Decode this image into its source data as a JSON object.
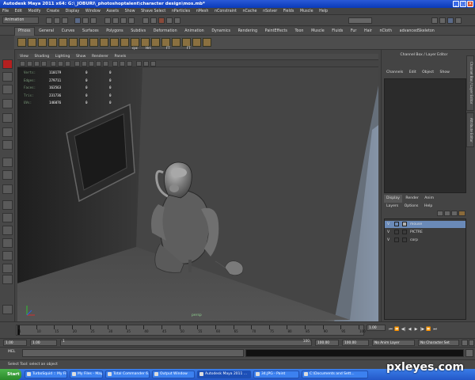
{
  "window": {
    "title": "Autodesk Maya 2011 x64: G:\\_JOBURI\\_photoshoptalent\\character design\\mos.mb*",
    "controls": [
      "_",
      "□",
      "×"
    ]
  },
  "menubar": [
    "File",
    "Edit",
    "Modify",
    "Create",
    "Display",
    "Window",
    "Assets",
    "Show",
    "Shave Select",
    "nParticles",
    "nMesh",
    "nConstraint",
    "nCache",
    "nSolver",
    "Fields",
    "Muscle",
    "Help"
  ],
  "status_line": {
    "mode": "Animation"
  },
  "shelf": {
    "tabs": [
      "Pfnoss",
      "General",
      "Curves",
      "Surfaces",
      "Polygons",
      "Subdivs",
      "Deformation",
      "Animation",
      "Dynamics",
      "Rendering",
      "PaintEffects",
      "Toon",
      "Muscle",
      "Fluids",
      "Fur",
      "Hair",
      "nCloth",
      "advancedSkeleton"
    ],
    "active_tab": 0,
    "icon_labels": [
      "cpc",
      "Hrs",
      "FT",
      "FT"
    ]
  },
  "viewport": {
    "menu": [
      "View",
      "Shading",
      "Lighting",
      "Show",
      "Renderer",
      "Panels"
    ],
    "hud": [
      {
        "label": "Verts:",
        "a": "110179",
        "b": "0",
        "c": "0"
      },
      {
        "label": "Edges:",
        "a": "279711",
        "b": "0",
        "c": "0"
      },
      {
        "label": "Faces:",
        "a": "163563",
        "b": "0",
        "c": "0"
      },
      {
        "label": "Tris:",
        "a": "231736",
        "b": "0",
        "c": "0"
      },
      {
        "label": "UVs:",
        "a": "146076",
        "b": "0",
        "c": "0"
      }
    ],
    "camera": "persp"
  },
  "channel_box": {
    "title": "Channel Box / Layer Editor",
    "menu": [
      "Channels",
      "Edit",
      "Object",
      "Show"
    ]
  },
  "side_tabs": [
    "Channel Box / Layer Editor",
    "Attribute Editor"
  ],
  "layer_editor": {
    "tabs": [
      "Display",
      "Render",
      "Anim"
    ],
    "menu": [
      "Layers",
      "Options",
      "Help"
    ],
    "layers": [
      {
        "visible": "V",
        "name": "mouse",
        "selected": true
      },
      {
        "visible": "V",
        "name": "PICTRE",
        "selected": false
      },
      {
        "visible": "V",
        "name": "corp",
        "selected": false
      }
    ]
  },
  "time_slider": {
    "ticks": [
      "1",
      "10",
      "15",
      "20",
      "25",
      "30",
      "35",
      "40",
      "45",
      "50",
      "55",
      "60",
      "65",
      "70",
      "75",
      "80",
      "85",
      "90",
      "95",
      "100"
    ],
    "current_frame": "1.00"
  },
  "range_slider": {
    "start": "1.00",
    "inner_start": "1.00",
    "slider_value": "1",
    "slider_end": "100",
    "end": "100.00",
    "outer_end": "100.00",
    "anim_layer": "No Anim Layer",
    "character_set": "No Character Set"
  },
  "command_line": {
    "label": "MEL"
  },
  "help_line": "Select Tool: select an object",
  "taskbar": {
    "start": "Start",
    "tasks": [
      {
        "label": "TurboSquid :: My Files ...",
        "active": false
      },
      {
        "label": "My Files - Maya...",
        "active": false
      },
      {
        "label": "Total Commander 6.03 ...",
        "active": false
      },
      {
        "label": "Output Window",
        "active": false
      },
      {
        "label": "Autodesk Maya 2011 ...",
        "active": true
      },
      {
        "label": "34.JPG - Paint",
        "active": false
      },
      {
        "label": "C:\\Documents and Sett...",
        "active": false
      }
    ]
  },
  "watermark": "pxleyes.com",
  "colors": {
    "accent_layer_selected": "#6a8ab8",
    "toolbox_select": "#b42020",
    "taskbar": "#2458c8",
    "start_button": "#3a9a3a"
  }
}
